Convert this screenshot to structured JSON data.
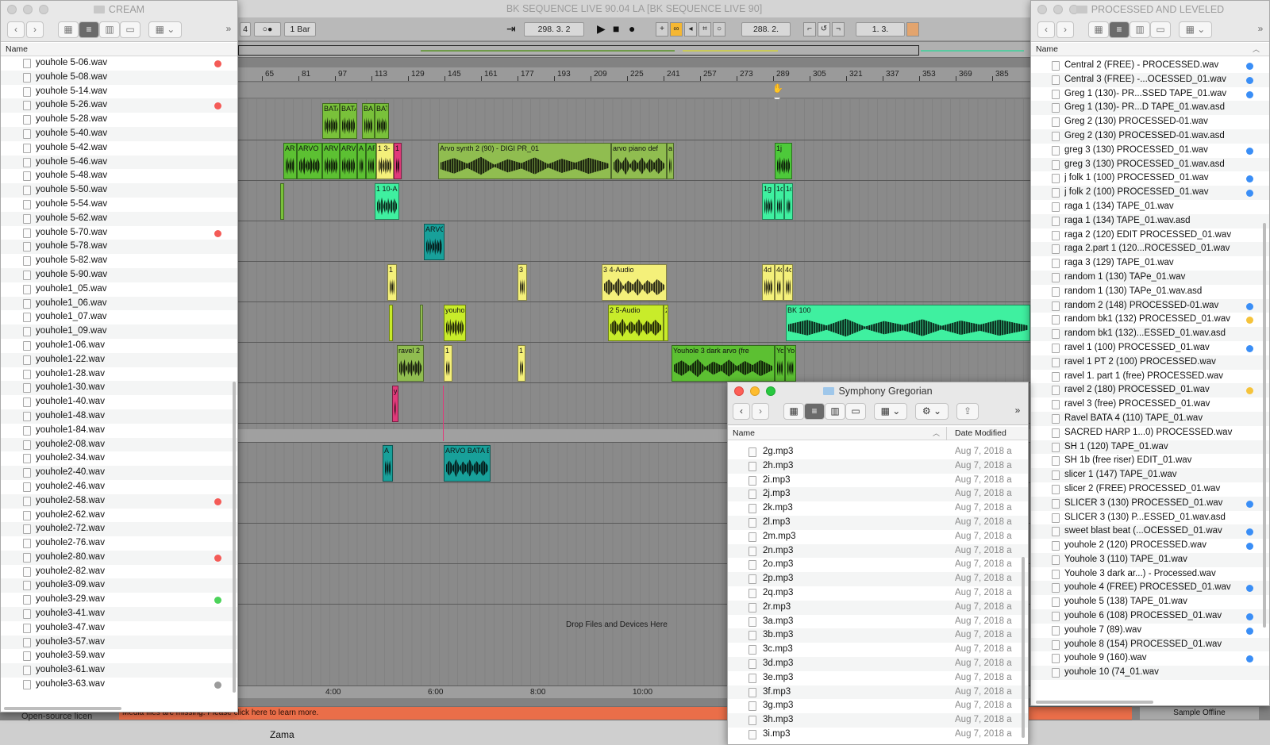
{
  "daw": {
    "title": "BK SEQUENCE LIVE 90.04 LA  [BK SEQUENCE LIVE 90]",
    "toolbar": {
      "meter_value": "4",
      "follow_glyph": "○●",
      "quantize": "1 Bar",
      "arrangement_position": "298.  3.  2",
      "loop_start": "288.  2.",
      "loop_length": "1.  3."
    },
    "ruler_bars": [
      "65",
      "81",
      "97",
      "113",
      "129",
      "145",
      "161",
      "177",
      "193",
      "209",
      "225",
      "241",
      "257",
      "273",
      "289",
      "305",
      "321",
      "337",
      "353",
      "369",
      "385"
    ],
    "time_marks": [
      "4:00",
      "6:00",
      "8:00",
      "10:00"
    ],
    "clips": {
      "bata1": "BATA",
      "bata2": "BATA",
      "bata3": "BA",
      "bata4": "BAT",
      "arvo_a": "AR",
      "arvo_b": "ARVO",
      "arvo_c": "ARV",
      "arvo_d": "ARV",
      "arvo_e": "A",
      "arvo_f": "AR",
      "yel13": "1 3-",
      "pink1": "1",
      "arvo_synth": "Arvo synth 2 (90) - DIGI PR_01",
      "arvo_piano": "arvo piano def",
      "arvo_ar": "ar",
      "green1j": "1j",
      "teal_110": "1 10-A",
      "teal_1g": "1g",
      "teal_1c": "1c",
      "teal_1c2": "1c",
      "arvo_teal": "ARVO",
      "yellow_11": "1 1",
      "yellow_3": "3",
      "audio_34": "3 4-Audio",
      "yellow_4d": "4d",
      "yellow_4a": "4c",
      "yellow_4b": "4c",
      "youho_lime": "youho",
      "audio_25": "2 5-Audio",
      "lime_2": "2",
      "bk100": "BK 100",
      "ravel2": "ravel 2",
      "yellow_1a": "1",
      "yellow_1b": "1",
      "youhole3_dark": "Youhole 3 dark arvo (fre",
      "you_a": "You",
      "you_b": "You",
      "pink_y": "y",
      "teal_a": "A",
      "arvo_bata": "ARVO BATA E"
    },
    "drop_hint": "Drop Files and Devices Here",
    "missing_message": "Media files are missing. Please click here to learn more.",
    "sample_offline": "Sample Offline",
    "open_source": "Open-source licen",
    "bottom_label": "Zama"
  },
  "cream": {
    "title": "CREAM",
    "column_name": "Name",
    "overflow": "»",
    "files": [
      {
        "name": "youhole 5-06.wav",
        "tag": "red"
      },
      {
        "name": "youhole 5-08.wav",
        "tag": ""
      },
      {
        "name": "youhole 5-14.wav",
        "tag": ""
      },
      {
        "name": "youhole 5-26.wav",
        "tag": "red"
      },
      {
        "name": "youhole 5-28.wav",
        "tag": ""
      },
      {
        "name": "youhole 5-40.wav",
        "tag": ""
      },
      {
        "name": "youhole 5-42.wav",
        "tag": ""
      },
      {
        "name": "youhole 5-46.wav",
        "tag": ""
      },
      {
        "name": "youhole 5-48.wav",
        "tag": ""
      },
      {
        "name": "youhole 5-50.wav",
        "tag": ""
      },
      {
        "name": "youhole 5-54.wav",
        "tag": ""
      },
      {
        "name": "youhole 5-62.wav",
        "tag": ""
      },
      {
        "name": "youhole 5-70.wav",
        "tag": "red"
      },
      {
        "name": "youhole 5-78.wav",
        "tag": ""
      },
      {
        "name": "youhole 5-82.wav",
        "tag": ""
      },
      {
        "name": "youhole 5-90.wav",
        "tag": ""
      },
      {
        "name": "youhole1_05.wav",
        "tag": ""
      },
      {
        "name": "youhole1_06.wav",
        "tag": ""
      },
      {
        "name": "youhole1_07.wav",
        "tag": ""
      },
      {
        "name": "youhole1_09.wav",
        "tag": ""
      },
      {
        "name": "youhole1-06.wav",
        "tag": ""
      },
      {
        "name": "youhole1-22.wav",
        "tag": ""
      },
      {
        "name": "youhole1-28.wav",
        "tag": ""
      },
      {
        "name": "youhole1-30.wav",
        "tag": ""
      },
      {
        "name": "youhole1-40.wav",
        "tag": ""
      },
      {
        "name": "youhole1-48.wav",
        "tag": ""
      },
      {
        "name": "youhole1-84.wav",
        "tag": ""
      },
      {
        "name": "youhole2-08.wav",
        "tag": ""
      },
      {
        "name": "youhole2-34.wav",
        "tag": ""
      },
      {
        "name": "youhole2-40.wav",
        "tag": ""
      },
      {
        "name": "youhole2-46.wav",
        "tag": ""
      },
      {
        "name": "youhole2-58.wav",
        "tag": "red"
      },
      {
        "name": "youhole2-62.wav",
        "tag": ""
      },
      {
        "name": "youhole2-72.wav",
        "tag": ""
      },
      {
        "name": "youhole2-76.wav",
        "tag": ""
      },
      {
        "name": "youhole2-80.wav",
        "tag": "red"
      },
      {
        "name": "youhole2-82.wav",
        "tag": ""
      },
      {
        "name": "youhole3-09.wav",
        "tag": ""
      },
      {
        "name": "youhole3-29.wav",
        "tag": "green"
      },
      {
        "name": "youhole3-41.wav",
        "tag": ""
      },
      {
        "name": "youhole3-47.wav",
        "tag": ""
      },
      {
        "name": "youhole3-57.wav",
        "tag": ""
      },
      {
        "name": "youhole3-59.wav",
        "tag": ""
      },
      {
        "name": "youhole3-61.wav",
        "tag": ""
      },
      {
        "name": "youhole3-63.wav",
        "tag": "gray"
      }
    ]
  },
  "processed": {
    "title": "PROCESSED AND LEVELED",
    "column_name": "Name",
    "overflow": "»",
    "files": [
      {
        "name": "Central 2 (FREE) - PROCESSED.wav",
        "tag": "blue",
        "kind": "audio"
      },
      {
        "name": "Central 3 (FREE) -...OCESSED_01.wav",
        "tag": "blue",
        "kind": "audio"
      },
      {
        "name": "Greg 1 (130)- PR...SSED TAPE_01.wav",
        "tag": "blue",
        "kind": "audio"
      },
      {
        "name": "Greg 1 (130)- PR...D TAPE_01.wav.asd",
        "tag": "",
        "kind": "doc"
      },
      {
        "name": "Greg 2 (130) PROCESSED-01.wav",
        "tag": "",
        "kind": "audio"
      },
      {
        "name": "Greg 2 (130) PROCESSED-01.wav.asd",
        "tag": "",
        "kind": "doc"
      },
      {
        "name": "greg 3 (130) PROCESSED_01.wav",
        "tag": "blue",
        "kind": "audio"
      },
      {
        "name": "greg 3 (130) PROCESSED_01.wav.asd",
        "tag": "",
        "kind": "doc"
      },
      {
        "name": "j folk 1 (100) PROCESSED_01.wav",
        "tag": "blue",
        "kind": "audio"
      },
      {
        "name": "j folk 2 (100) PROCESSED_01.wav",
        "tag": "blue",
        "kind": "audio"
      },
      {
        "name": "raga 1 (134) TAPE_01.wav",
        "tag": "",
        "kind": "audio"
      },
      {
        "name": "raga 1 (134) TAPE_01.wav.asd",
        "tag": "",
        "kind": "doc"
      },
      {
        "name": "raga 2 (120) EDIT PROCESSED_01.wav",
        "tag": "",
        "kind": "audio"
      },
      {
        "name": "raga 2.part 1 (120...ROCESSED_01.wav",
        "tag": "",
        "kind": "audio"
      },
      {
        "name": "raga 3 (129) TAPE_01.wav",
        "tag": "",
        "kind": "audio"
      },
      {
        "name": "random 1 (130) TAPe_01.wav",
        "tag": "",
        "kind": "audio"
      },
      {
        "name": "random 1 (130) TAPe_01.wav.asd",
        "tag": "",
        "kind": "doc"
      },
      {
        "name": "random 2 (148) PROCESSED-01.wav",
        "tag": "blue",
        "kind": "audio"
      },
      {
        "name": "random bk1 (132) PROCESSED_01.wav",
        "tag": "yellow",
        "kind": "audio"
      },
      {
        "name": "random bk1 (132)...ESSED_01.wav.asd",
        "tag": "",
        "kind": "doc"
      },
      {
        "name": "ravel 1 (100) PROCESSED_01.wav",
        "tag": "blue",
        "kind": "audio"
      },
      {
        "name": "ravel 1 PT 2 (100) PROCESSED.wav",
        "tag": "",
        "kind": "audio"
      },
      {
        "name": "ravel 1. part 1 (free) PROCESSED.wav",
        "tag": "",
        "kind": "audio"
      },
      {
        "name": "ravel 2 (180) PROCESSED_01.wav",
        "tag": "yellow",
        "kind": "audio"
      },
      {
        "name": "ravel 3 (free) PROCESSED_01.wav",
        "tag": "",
        "kind": "audio"
      },
      {
        "name": "Ravel BATA 4 (110) TAPE_01.wav",
        "tag": "",
        "kind": "audio"
      },
      {
        "name": "SACRED HARP 1...0) PROCESSED.wav",
        "tag": "",
        "kind": "audio"
      },
      {
        "name": "SH 1 (120) TAPE_01.wav",
        "tag": "",
        "kind": "audio"
      },
      {
        "name": "SH 1b (free riser) EDIT_01.wav",
        "tag": "",
        "kind": "audio"
      },
      {
        "name": "slicer 1 (147) TAPE_01.wav",
        "tag": "",
        "kind": "audio"
      },
      {
        "name": "slicer 2 (FREE) PROCESSED_01.wav",
        "tag": "",
        "kind": "audio"
      },
      {
        "name": "SLICER 3 (130) PROCESSED_01.wav",
        "tag": "blue",
        "kind": "audio"
      },
      {
        "name": "SLICER 3 (130) P...ESSED_01.wav.asd",
        "tag": "",
        "kind": "doc"
      },
      {
        "name": "sweet blast beat (...OCESSED_01.wav",
        "tag": "blue",
        "kind": "audio"
      },
      {
        "name": "youhole 2 (120) PROCESSED.wav",
        "tag": "blue",
        "kind": "audio"
      },
      {
        "name": "Youhole 3 (110) TAPE_01.wav",
        "tag": "",
        "kind": "audio"
      },
      {
        "name": "Youhole 3 dark ar...) - Processed.wav",
        "tag": "",
        "kind": "audio"
      },
      {
        "name": "youhole 4 (FREE) PROCESSED_01.wav",
        "tag": "blue",
        "kind": "audio"
      },
      {
        "name": "youhole 5 (138) TAPE_01.wav",
        "tag": "",
        "kind": "audio"
      },
      {
        "name": "youhole 6 (108) PROCESSED_01.wav",
        "tag": "blue",
        "kind": "audio"
      },
      {
        "name": "youhole 7 (89).wav",
        "tag": "blue",
        "kind": "audio"
      },
      {
        "name": "youhole 8 (154) PROCESSED_01.wav",
        "tag": "",
        "kind": "audio"
      },
      {
        "name": "youhole 9 (160).wav",
        "tag": "blue",
        "kind": "audio"
      },
      {
        "name": "youhole 10 (74_01.wav",
        "tag": "",
        "kind": "audio"
      }
    ]
  },
  "symphony": {
    "title": "Symphony Gregorian",
    "column_name": "Name",
    "column_date": "Date Modified",
    "overflow": "»",
    "date_value": "Aug 7, 2018 a",
    "files": [
      "2g.mp3",
      "2h.mp3",
      "2i.mp3",
      "2j.mp3",
      "2k.mp3",
      "2l.mp3",
      "2m.mp3",
      "2n.mp3",
      "2o.mp3",
      "2p.mp3",
      "2q.mp3",
      "2r.mp3",
      "3a.mp3",
      "3b.mp3",
      "3c.mp3",
      "3d.mp3",
      "3e.mp3",
      "3f.mp3",
      "3g.mp3",
      "3h.mp3",
      "3i.mp3"
    ]
  },
  "colors": {
    "clip_green": "#79c13a",
    "clip_lime": "#c8ec2a",
    "clip_yellow": "#f4f07a",
    "clip_mint": "#3ff0a0",
    "clip_teal": "#18a09a",
    "clip_pink": "#e03a7a",
    "clip_olive": "#90bd50",
    "tag_red": "#f45b57",
    "tag_blue": "#3a8ef6",
    "tag_yellow": "#f5c33b",
    "tag_green": "#4cd35a",
    "tag_gray": "#9b9b9b",
    "missing_bar": "#ea6e49"
  }
}
